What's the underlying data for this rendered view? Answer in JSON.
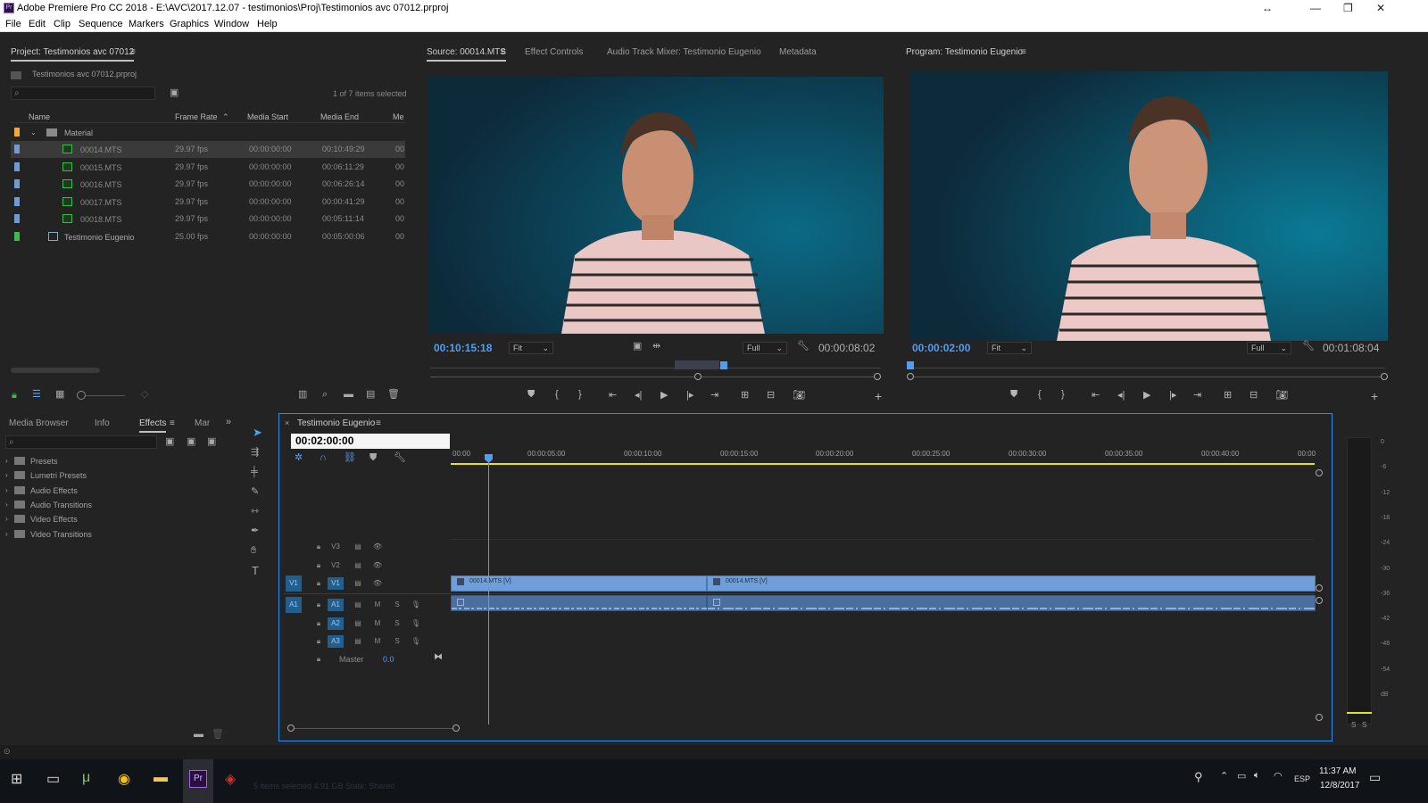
{
  "window": {
    "title": "Adobe Premiere Pro CC 2018 - E:\\AVC\\2017.12.07 - testimonios\\Proj\\Testimonios avc 07012.prproj",
    "app_icon": "Pr"
  },
  "menu": [
    "File",
    "Edit",
    "Clip",
    "Sequence",
    "Markers",
    "Graphics",
    "Window",
    "Help"
  ],
  "project": {
    "tab": "Project: Testimonios avc 07012",
    "file": "Testimonios avc 07012.prproj",
    "selection": "1 of 7 items selected",
    "columns": [
      "Name",
      "Frame Rate",
      "Media Start",
      "Media End",
      "Me"
    ],
    "bin": "Material",
    "rows": [
      {
        "name": "00014.MTS",
        "fps": "29.97 fps",
        "start": "00:00:00:00",
        "end": "00:10:49:29",
        "extra": "00",
        "color": "#6f9bd6",
        "selected": true
      },
      {
        "name": "00015.MTS",
        "fps": "29.97 fps",
        "start": "00:00:00:00",
        "end": "00:06:11:29",
        "extra": "00",
        "color": "#6f9bd6",
        "selected": false
      },
      {
        "name": "00016.MTS",
        "fps": "29.97 fps",
        "start": "00:00:00:00",
        "end": "00:06:26:14",
        "extra": "00",
        "color": "#6f9bd6",
        "selected": false
      },
      {
        "name": "00017.MTS",
        "fps": "29.97 fps",
        "start": "00:00:00:00",
        "end": "00:00:41:29",
        "extra": "00",
        "color": "#6f9bd6",
        "selected": false
      },
      {
        "name": "00018.MTS",
        "fps": "29.97 fps",
        "start": "00:00:00:00",
        "end": "00:05:11:14",
        "extra": "00",
        "color": "#6f9bd6",
        "selected": false
      },
      {
        "name": "Testimonio Eugenio",
        "fps": "25.00 fps",
        "start": "00:00:00:00",
        "end": "00:05:00:06",
        "extra": "00",
        "color": "#3dbb4a",
        "selected": false
      }
    ]
  },
  "source": {
    "tabs": [
      "Source: 00014.MTS",
      "Effect Controls",
      "Audio Track Mixer: Testimonio Eugenio",
      "Metadata"
    ],
    "timecode": "00:10:15:18",
    "fit": "Fit",
    "quality": "Full",
    "duration": "00:00:08:02"
  },
  "program": {
    "tab": "Program: Testimonio Eugenio",
    "timecode": "00:00:02:00",
    "fit": "Fit",
    "quality": "Full",
    "duration": "00:01:08:04"
  },
  "effects": {
    "tabs": [
      "Media Browser",
      "Info",
      "Effects",
      "Mar"
    ],
    "items": [
      "Presets",
      "Lumetri Presets",
      "Audio Effects",
      "Audio Transitions",
      "Video Effects",
      "Video Transitions"
    ]
  },
  "timeline": {
    "tab": "Testimonio Eugenio",
    "timecode": "00:02:00:00",
    "ruler": [
      "00:00",
      "00:00:05:00",
      "00:00:10:00",
      "00:00:15:00",
      "00:00:20:00",
      "00:00:25:00",
      "00:00:30:00",
      "00:00:35:00",
      "00:00:40:00",
      "00:00"
    ],
    "video_tracks": [
      "V3",
      "V2",
      "V1"
    ],
    "audio_tracks": [
      "A1",
      "A2",
      "A3"
    ],
    "src_v": "V1",
    "src_a": "A1",
    "master": {
      "label": "Master",
      "value": "0.0"
    },
    "clips": [
      {
        "label": "00014.MTS [V]"
      },
      {
        "label": "00014.MTS [V]"
      }
    ],
    "track_btns": {
      "m": "M",
      "s": "S"
    }
  },
  "meter": {
    "labels": [
      "0",
      "-6",
      "-12",
      "-18",
      "-24",
      "-30",
      "-36",
      "-42",
      "-48",
      "-54",
      "dB"
    ],
    "solo": [
      "S",
      "S"
    ]
  },
  "taskbar": {
    "time": "11:37 AM",
    "date": "12/8/2017",
    "lang": "ESP",
    "status": "5 items selected  4.91 GB    State: Shared"
  },
  "colors": {
    "accent": "#2d8ceb",
    "timecode": "#4d9ef5",
    "clip_video": "#6f9ed9",
    "clip_audio": "#4a6e9e",
    "playhead": "#4d9ef5"
  }
}
